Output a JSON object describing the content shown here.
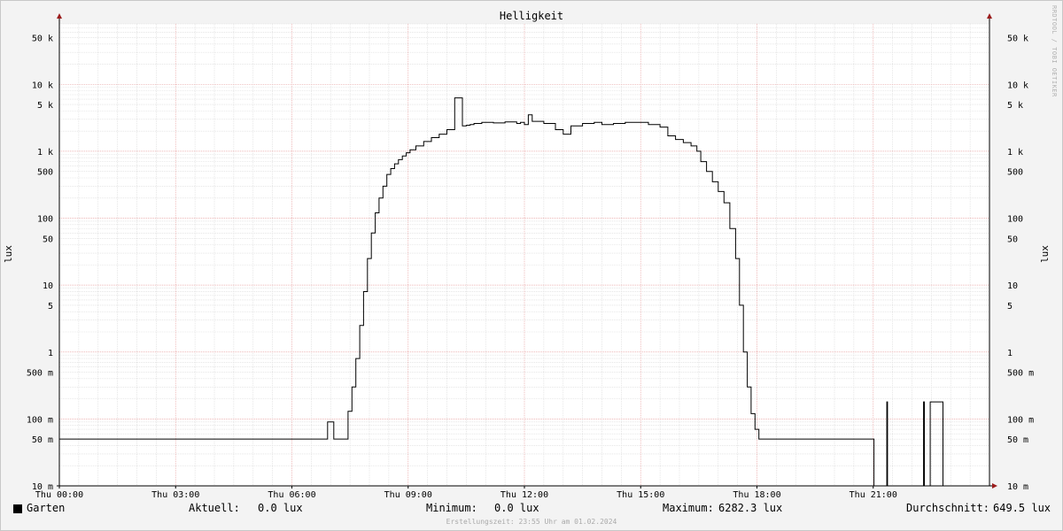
{
  "chart_data": {
    "type": "line",
    "title": "Helligkeit",
    "ylabel": "lux",
    "ylabel_right": "lux",
    "scale": "log",
    "ylim": [
      0.01,
      80000
    ],
    "xlim": [
      0,
      24
    ],
    "grid": true,
    "x_ticks": [
      {
        "x": 0,
        "label": "Thu 00:00"
      },
      {
        "x": 3,
        "label": "Thu 03:00"
      },
      {
        "x": 6,
        "label": "Thu 06:00"
      },
      {
        "x": 9,
        "label": "Thu 09:00"
      },
      {
        "x": 12,
        "label": "Thu 12:00"
      },
      {
        "x": 15,
        "label": "Thu 15:00"
      },
      {
        "x": 18,
        "label": "Thu 18:00"
      },
      {
        "x": 21,
        "label": "Thu 21:00"
      }
    ],
    "y_ticks": [
      {
        "y": 50000,
        "label": "50 k"
      },
      {
        "y": 10000,
        "label": "10 k"
      },
      {
        "y": 5000,
        "label": "5 k"
      },
      {
        "y": 1000,
        "label": "1 k"
      },
      {
        "y": 500,
        "label": "500"
      },
      {
        "y": 100,
        "label": "100"
      },
      {
        "y": 50,
        "label": "50"
      },
      {
        "y": 10,
        "label": "10"
      },
      {
        "y": 5,
        "label": "5"
      },
      {
        "y": 1,
        "label": "1"
      },
      {
        "y": 0.5,
        "label": "500 m"
      },
      {
        "y": 0.1,
        "label": "100 m"
      },
      {
        "y": 0.05,
        "label": "50 m"
      },
      {
        "y": 0.01,
        "label": "10 m"
      }
    ],
    "series": [
      {
        "name": "Garten",
        "color": "#000000",
        "x": [
          0,
          6.9,
          6.92,
          7.05,
          7.08,
          7.4,
          7.45,
          7.55,
          7.65,
          7.75,
          7.85,
          7.95,
          8.05,
          8.15,
          8.25,
          8.35,
          8.45,
          8.55,
          8.65,
          8.75,
          8.85,
          8.95,
          9.05,
          9.2,
          9.4,
          9.6,
          9.8,
          10.0,
          10.2,
          10.4,
          10.5,
          10.6,
          10.7,
          10.9,
          11.2,
          11.5,
          11.8,
          11.9,
          12.0,
          12.1,
          12.2,
          12.5,
          12.8,
          13.0,
          13.2,
          13.5,
          13.8,
          14.0,
          14.3,
          14.6,
          14.9,
          15.2,
          15.5,
          15.7,
          15.9,
          16.1,
          16.3,
          16.45,
          16.55,
          16.7,
          16.85,
          17.0,
          17.15,
          17.3,
          17.45,
          17.55,
          17.65,
          17.75,
          17.85,
          17.95,
          18.05,
          18.15,
          18.2,
          21.0,
          21.02,
          21.35,
          21.37,
          21.5,
          21.52,
          22.3,
          22.32,
          22.45,
          22.47,
          22.8,
          22.82,
          22.88,
          22.9,
          24
        ],
        "values": [
          0.05,
          0.05,
          0.09,
          0.09,
          0.05,
          0.05,
          0.13,
          0.3,
          0.8,
          2.5,
          8,
          25,
          60,
          120,
          200,
          300,
          450,
          550,
          650,
          750,
          850,
          950,
          1050,
          1200,
          1400,
          1600,
          1800,
          2100,
          6282.3,
          2400,
          2450,
          2500,
          2600,
          2700,
          2650,
          2750,
          2600,
          2700,
          2500,
          3500,
          2800,
          2600,
          2100,
          1800,
          2400,
          2600,
          2700,
          2500,
          2600,
          2700,
          2700,
          2500,
          2300,
          1700,
          1500,
          1350,
          1200,
          1000,
          700,
          500,
          350,
          250,
          170,
          70,
          25,
          5,
          1,
          0.3,
          0.12,
          0.07,
          0.05,
          0.05,
          0.05,
          0.05,
          0.01,
          0.18,
          0.01,
          0.01,
          0.01,
          0.18,
          0.01,
          0.01,
          0.18,
          0.01,
          0.01,
          0.01,
          0.01,
          0.01
        ]
      }
    ]
  },
  "watermark": "RRDTOOL / TOBI OETIKER",
  "legend": {
    "series_name": "Garten",
    "current_label": "Aktuell:",
    "current_value": "0.0 lux",
    "min_label": "Minimum:",
    "min_value": "0.0 lux",
    "max_label": "Maximum:",
    "max_value": "6282.3 lux",
    "avg_label": "Durchschnitt:",
    "avg_value": "649.5 lux"
  },
  "generated_text": "Erstellungszeit: 23:55 Uhr am 01.02.2024",
  "colors": {
    "canvas": "#ffffff",
    "background": "#f3f3f3",
    "major_grid": "#e8a0a0",
    "minor_grid": "#d8d8d8",
    "line": "#000000",
    "axis_arrow": "#9b1c1c"
  }
}
